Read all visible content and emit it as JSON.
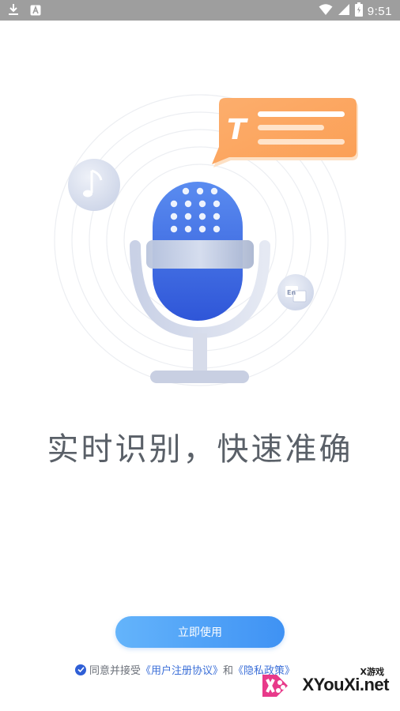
{
  "status_bar": {
    "time": "9:51",
    "left_icons": [
      "download-icon",
      "a-box-icon"
    ],
    "right_icons": [
      "wifi-icon",
      "cellular-signal-icon",
      "battery-icon"
    ]
  },
  "illustration": {
    "subject": "microphone-icon",
    "music_badge": "music-note-icon",
    "translate_badge": "translate-icon",
    "text_bubble_letter": "T",
    "translate_badge_text": "En"
  },
  "slogan": "实时识别，快速准确",
  "start_button": {
    "label": "立即使用"
  },
  "agreement": {
    "prefix": "同意并接受",
    "user_agreement": "《用户注册协议》",
    "and": "和",
    "privacy_policy": "《隐私政策》"
  },
  "watermark": {
    "top": "X游戏",
    "main": "XYouXi.net"
  },
  "colors": {
    "status_bar": "#9e9e9e",
    "slogan": "#5a6068",
    "button_start": "#64b4fb",
    "button_end": "#3f92f4",
    "link": "#3b6fd8",
    "bubble": "#fca760",
    "mic_blue": "#3f6de6"
  }
}
